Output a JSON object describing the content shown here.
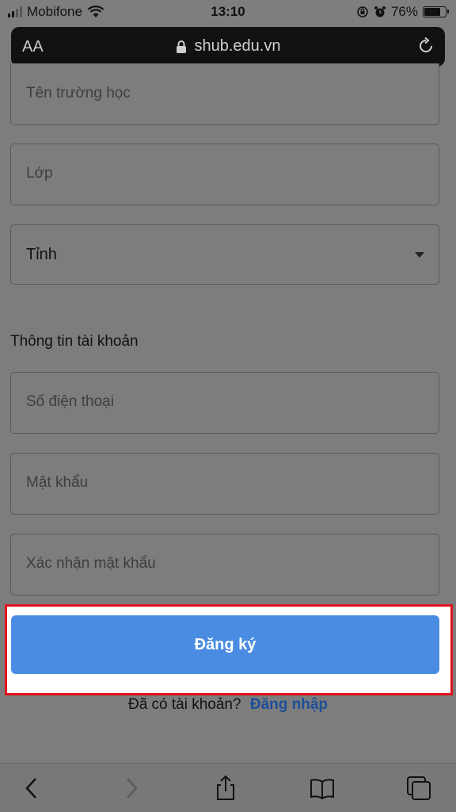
{
  "status_bar": {
    "carrier": "Mobifone",
    "time": "13:10",
    "battery": "76%",
    "battery_level": 0.76
  },
  "browser": {
    "text_size_label": "AA",
    "url": "shub.edu.vn"
  },
  "form": {
    "school_placeholder": "Tên trường học",
    "class_placeholder": "Lớp",
    "province_value": "Tỉnh",
    "account_section_title": "Thông tin tài khoản",
    "phone_placeholder": "Số điện thoại",
    "password_placeholder": "Mật khẩu",
    "confirm_password_placeholder": "Xác nhận mật khẩu",
    "register_label": "Đăng ký",
    "have_account_text": "Đã có tài khoản?",
    "login_link": "Đăng nhập"
  },
  "colors": {
    "accent": "#4a8ce2",
    "highlight_border": "#e0141e",
    "link": "#1e4f98"
  },
  "toolbar": {
    "icons": [
      "back-icon",
      "forward-icon",
      "share-icon",
      "bookmarks-icon",
      "tabs-icon"
    ]
  }
}
